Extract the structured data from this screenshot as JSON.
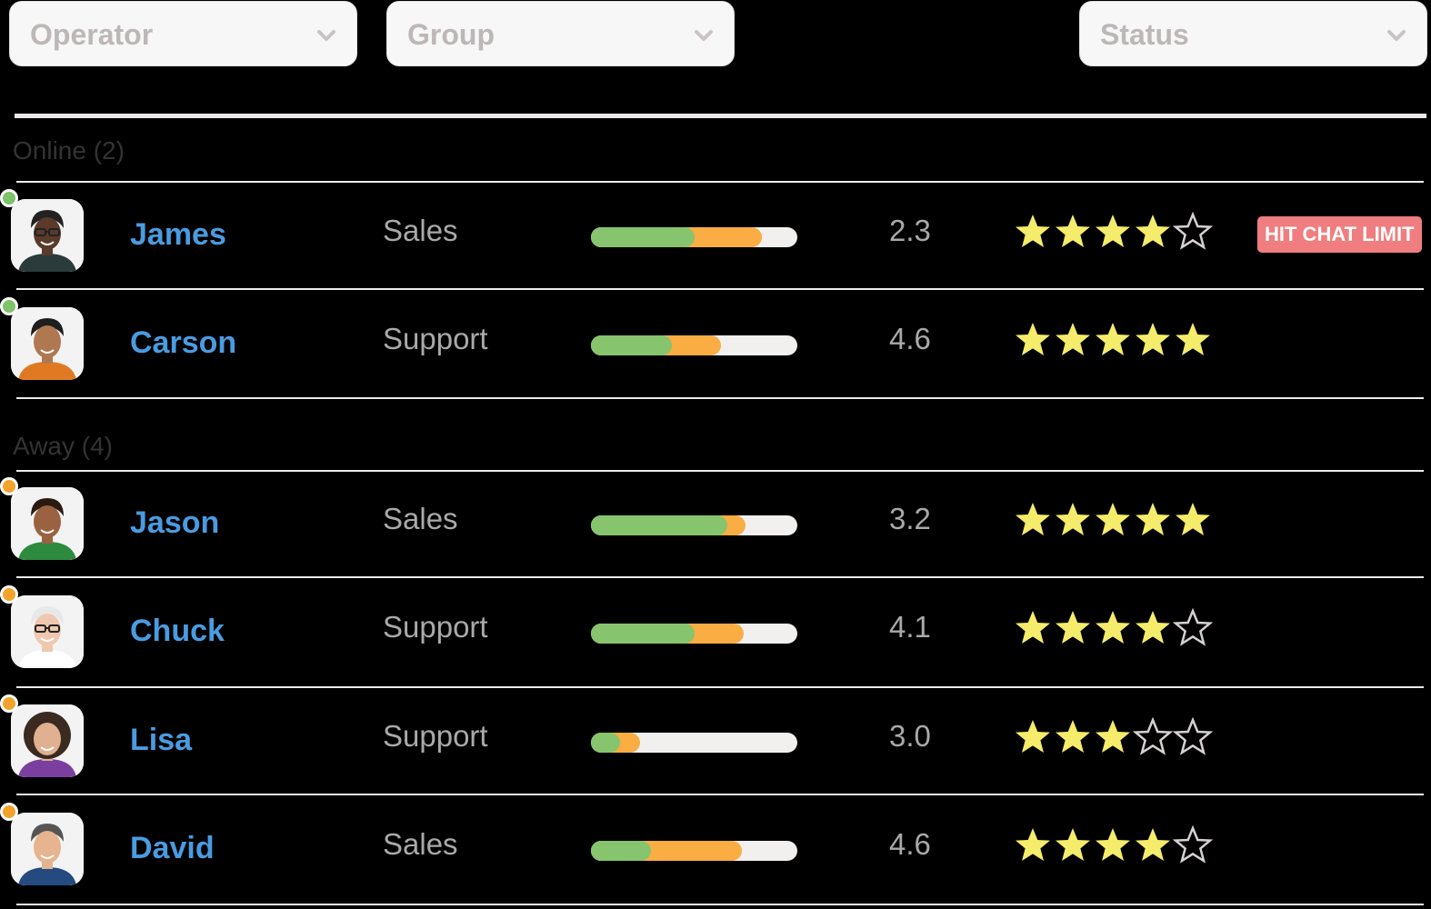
{
  "filters": {
    "operator": "Operator",
    "group": "Group",
    "status": "Status"
  },
  "colors": {
    "online": "#7cc36a",
    "away": "#f3a32c",
    "bar_green": "#86c46e",
    "bar_orange": "#f9ad43",
    "bar_track": "#f2efef",
    "star_filled": "#f5ec6b",
    "star_empty": "#d6d1d1",
    "name": "#4a9be0",
    "badge": "#f07d7f"
  },
  "sections": [
    {
      "label": "Online (2)",
      "status": "online",
      "operators": [
        {
          "name": "James",
          "group": "Sales",
          "score": "2.3",
          "bar": {
            "green": 0.5,
            "orange": 0.33
          },
          "rating": 4,
          "badge": "HIT CHAT LIMIT",
          "avatar": "avatar-james"
        },
        {
          "name": "Carson",
          "group": "Support",
          "score": "4.6",
          "bar": {
            "green": 0.39,
            "orange": 0.24
          },
          "rating": 5,
          "badge": null,
          "avatar": "avatar-carson"
        }
      ]
    },
    {
      "label": "Away (4)",
      "status": "away",
      "operators": [
        {
          "name": "Jason",
          "group": "Sales",
          "score": "3.2",
          "bar": {
            "green": 0.66,
            "orange": 0.09
          },
          "rating": 5,
          "badge": null,
          "avatar": "avatar-jason"
        },
        {
          "name": "Chuck",
          "group": "Support",
          "score": "4.1",
          "bar": {
            "green": 0.5,
            "orange": 0.24
          },
          "rating": 4,
          "badge": null,
          "avatar": "avatar-chuck"
        },
        {
          "name": "Lisa",
          "group": "Support",
          "score": "3.0",
          "bar": {
            "green": 0.14,
            "orange": 0.1
          },
          "rating": 3,
          "badge": null,
          "avatar": "avatar-lisa"
        },
        {
          "name": "David",
          "group": "Sales",
          "score": "4.6",
          "bar": {
            "green": 0.29,
            "orange": 0.44
          },
          "rating": 4,
          "badge": null,
          "avatar": "avatar-david"
        }
      ]
    }
  ]
}
